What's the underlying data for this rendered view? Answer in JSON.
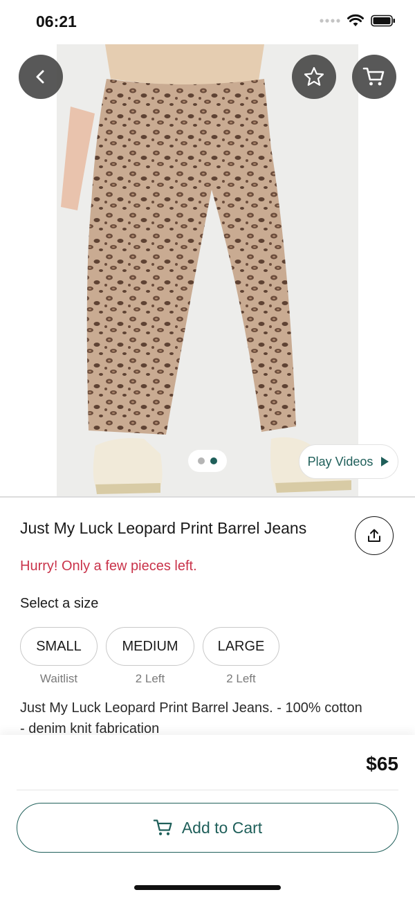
{
  "status_bar": {
    "time": "06:21"
  },
  "hero": {
    "icons": {
      "back": "chevron-left-icon",
      "favorite": "star-icon",
      "cart": "cart-icon"
    },
    "pager": {
      "total": 2,
      "active_index": 1
    },
    "play_videos_label": "Play Videos"
  },
  "product": {
    "title": "Just My Luck Leopard Print Barrel Jeans",
    "stock_warning": "Hurry! Only a few pieces left.",
    "size_prompt": "Select a size",
    "sizes": [
      {
        "label": "SMALL",
        "note": "Waitlist"
      },
      {
        "label": "MEDIUM",
        "note": "2 Left"
      },
      {
        "label": "LARGE",
        "note": "2 Left"
      }
    ],
    "description_line1": "Just My Luck Leopard Print Barrel Jeans. - 100% cotton",
    "description_line2": "- denim knit fabrication"
  },
  "checkout": {
    "price": "$65",
    "add_to_cart_label": "Add to Cart"
  },
  "colors": {
    "accent": "#1f5f5a",
    "warning": "#c9334a",
    "overlay_button": "#464646"
  }
}
